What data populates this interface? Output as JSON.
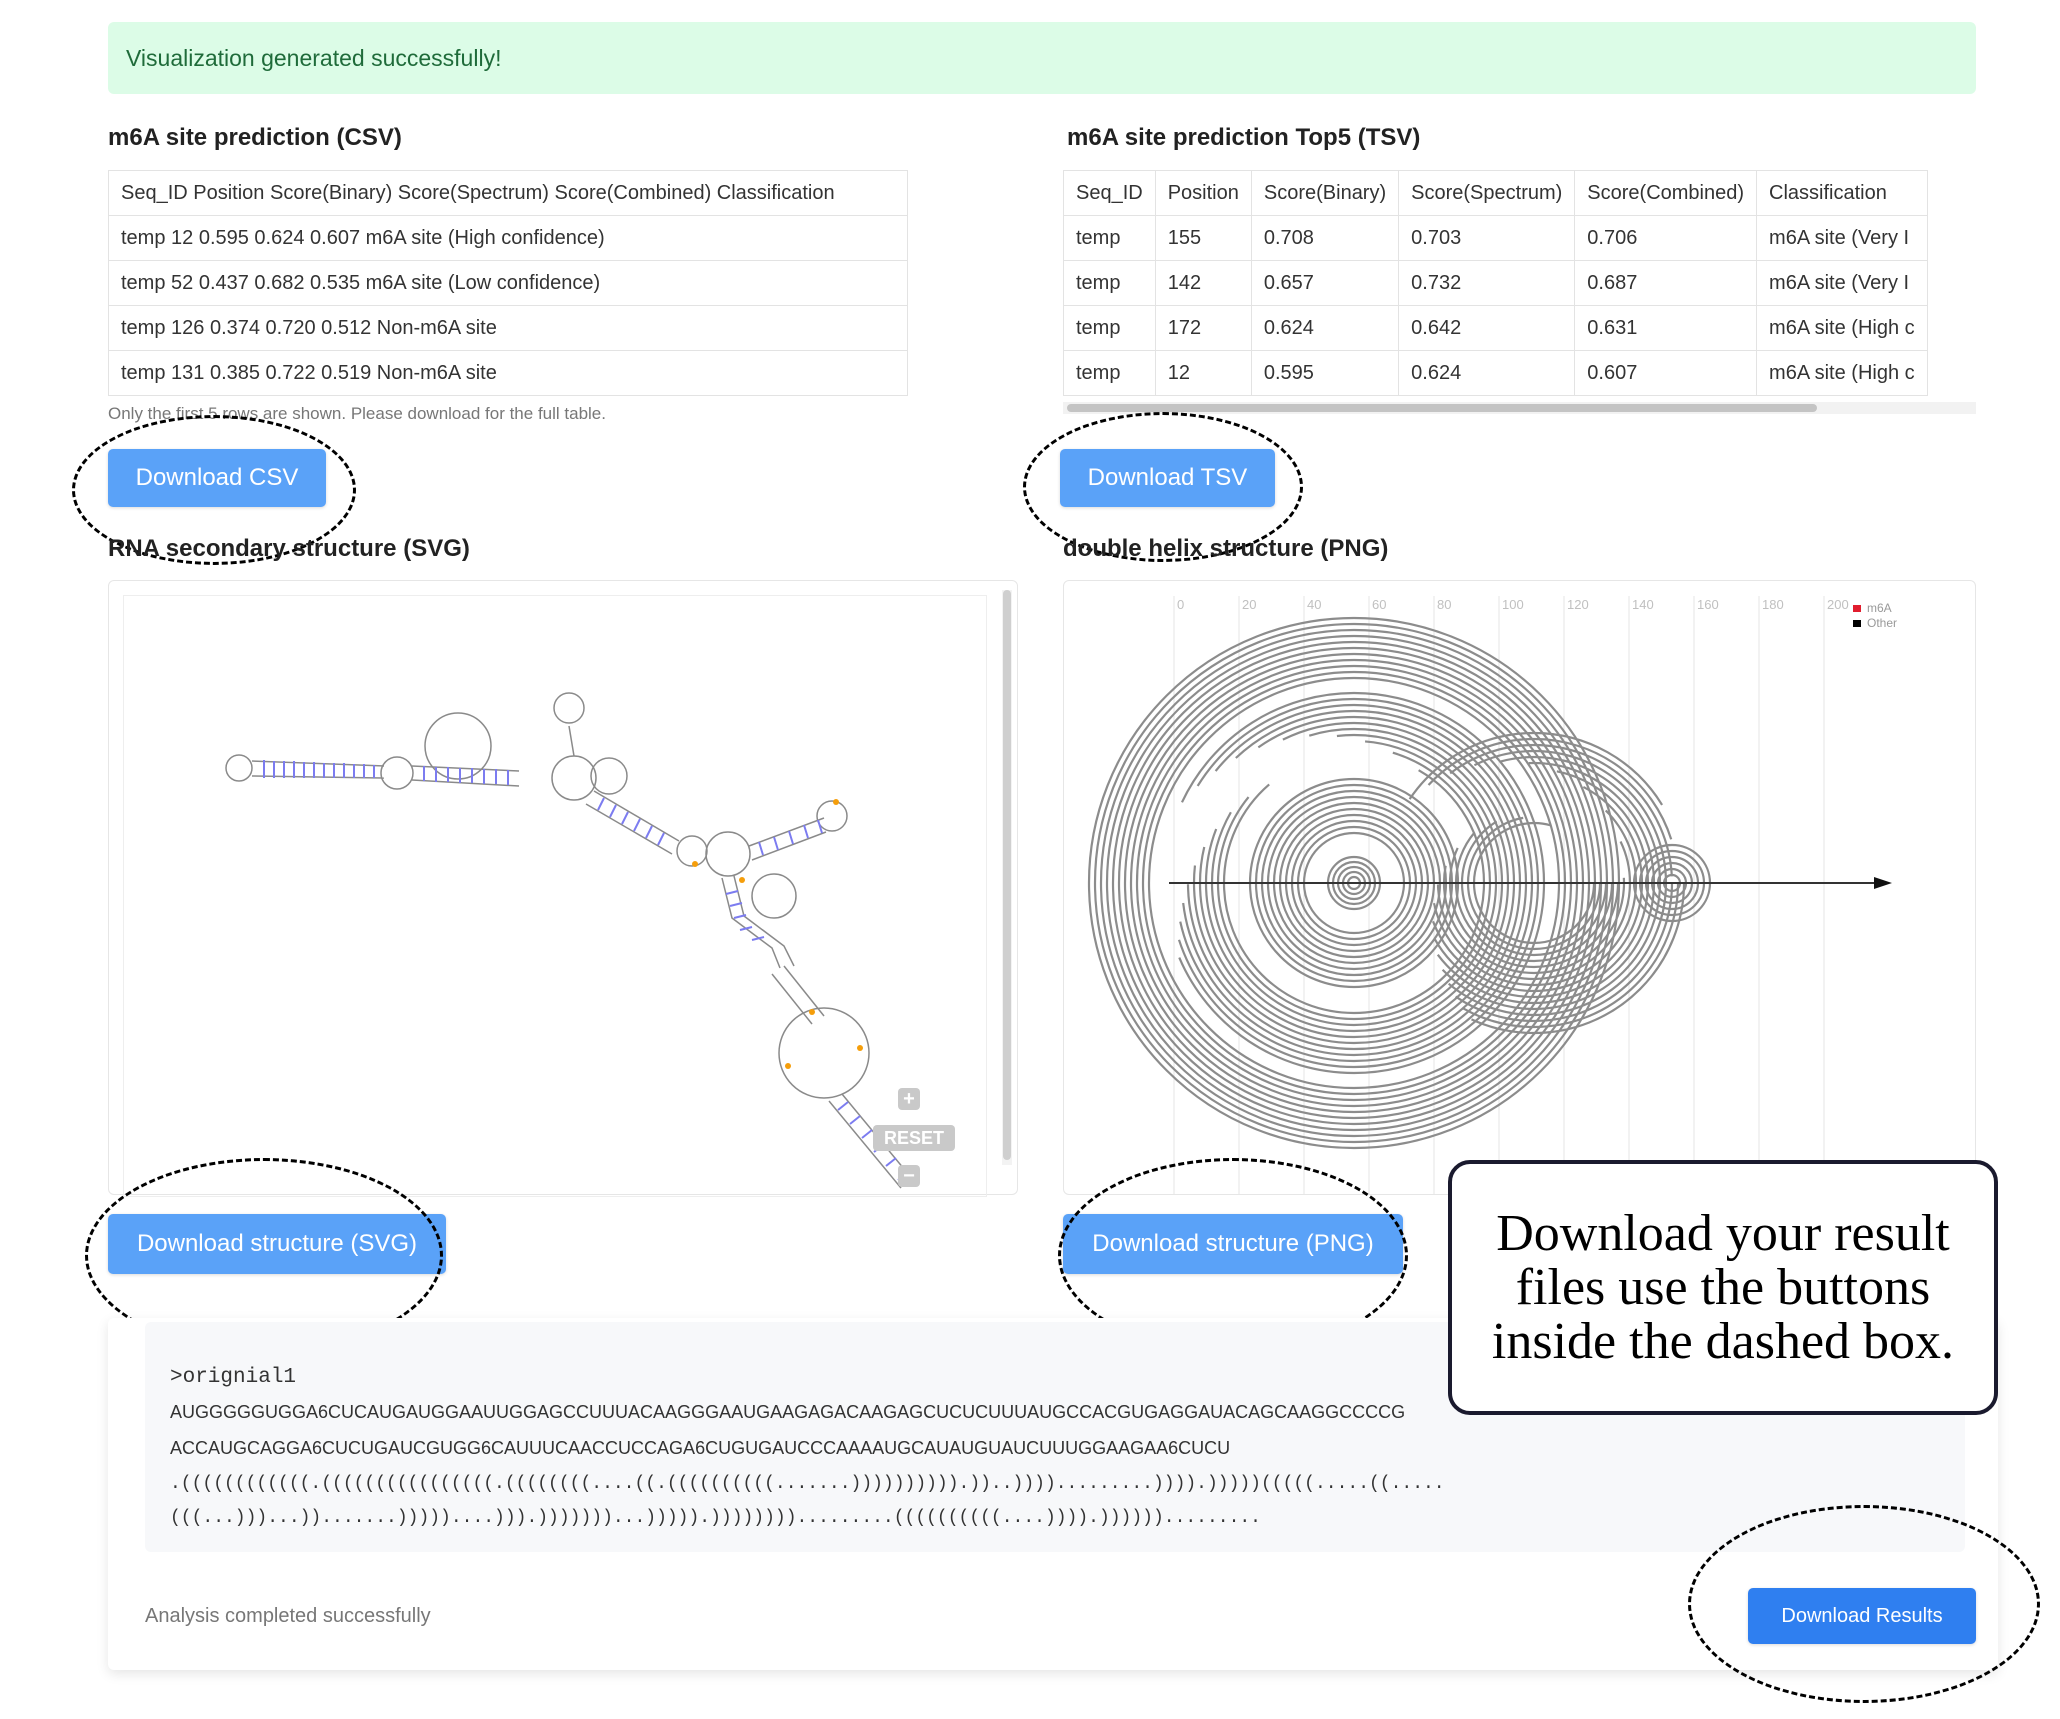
{
  "alert": {
    "message": "Visualization generated successfully!"
  },
  "csv_section": {
    "title": "m6A site prediction (CSV)",
    "header": "Seq_ID Position Score(Binary) Score(Spectrum) Score(Combined) Classification",
    "rows": [
      "temp 12 0.595 0.624 0.607 m6A site (High confidence)",
      "temp 52 0.437 0.682 0.535 m6A site (Low confidence)",
      "temp 126 0.374 0.720 0.512 Non-m6A site",
      "temp 131 0.385 0.722 0.519 Non-m6A site"
    ],
    "note": "Only the first 5 rows are shown. Please download for the full table.",
    "download_label": "Download CSV"
  },
  "tsv_section": {
    "title": "m6A site prediction Top5 (TSV)",
    "columns": [
      "Seq_ID",
      "Position",
      "Score(Binary)",
      "Score(Spectrum)",
      "Score(Combined)",
      "Classification"
    ],
    "rows": [
      [
        "temp",
        "155",
        "0.708",
        "0.703",
        "0.706",
        "m6A site (Very I"
      ],
      [
        "temp",
        "142",
        "0.657",
        "0.732",
        "0.687",
        "m6A site (Very I"
      ],
      [
        "temp",
        "172",
        "0.624",
        "0.642",
        "0.631",
        "m6A site (High c"
      ],
      [
        "temp",
        "12",
        "0.595",
        "0.624",
        "0.607",
        "m6A site (High c"
      ]
    ],
    "download_label": "Download TSV"
  },
  "svg_section": {
    "title": "RNA secondary structure (SVG)",
    "zoom_in": "+",
    "reset": "RESET",
    "zoom_out": "−",
    "download_label": "Download structure (SVG)"
  },
  "png_section": {
    "title": "double helix structure (PNG)",
    "axis_ticks": [
      "0",
      "20",
      "40",
      "60",
      "80",
      "100",
      "120",
      "140",
      "160",
      "180",
      "200"
    ],
    "legend": [
      {
        "label": "m6A",
        "color": "#e11d2e"
      },
      {
        "label": "Other",
        "color": "#000000"
      }
    ],
    "download_label": "Download structure (PNG)"
  },
  "callout": {
    "text": "Download your result files use the buttons inside the dashed box."
  },
  "sequence": {
    "name": ">orignial1",
    "line1": "AUGGGGGUGGA6CUCAUGAUGGAAUUGGAGCCUUUACAAGGGAAUGAAGAGACAAGAGCUCUCUUUAUGCCACGUGAGGAUACAGCAAGGCCCCG",
    "line2": "ACCAUGCAGGA6CUCUGAUCGUGG6CAUUUCAACCUCCAGA6CUGUGAUCCCAAAAUGCAUAUGUAUCUUUGGAAGAA6CUCU",
    "line3": ".((((((((((((.((((((((((((((((.((((((((....((.((((((((((.......)))))))))).))..)))).........)))).)))))(((((.....((.....",
    "line4": "(((...)))...)).......)))))....))).)))))))...))))).)))))))).........((((((((((....)))).))))))........."
  },
  "status": {
    "text": "Analysis completed successfully",
    "download_results_label": "Download Results"
  }
}
